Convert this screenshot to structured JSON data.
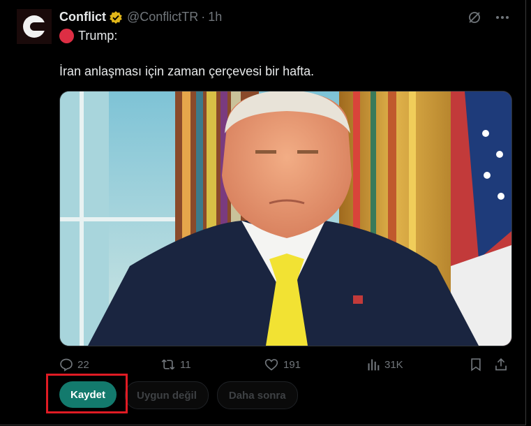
{
  "author": {
    "name": "Conflict",
    "handle": "@ConflictTR",
    "separator": "·",
    "time": "1h"
  },
  "icons": {
    "avatar": "conflict-logo",
    "verified": "verified-badge-icon",
    "grok": "grok-icon",
    "more": "more-icon",
    "reply": "reply-icon",
    "repost": "repost-icon",
    "like": "like-icon",
    "views": "views-icon",
    "bookmark": "bookmark-icon",
    "share": "share-icon"
  },
  "tweet": {
    "speaker": "Trump:",
    "text": "İran anlaşması için zaman çerçevesi bir hafta."
  },
  "stats": {
    "replies": "22",
    "reposts": "11",
    "likes": "191",
    "views": "31K"
  },
  "feedback": {
    "save": "Kaydet",
    "not_relevant": "Uygun değil",
    "later": "Daha sonra"
  },
  "colors": {
    "accent": "#137a6d",
    "verified": "#e2b719",
    "highlight": "#e01b24",
    "red_dot": "#dd2e44"
  }
}
